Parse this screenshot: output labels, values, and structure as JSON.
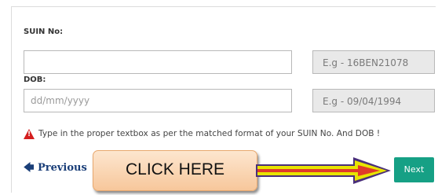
{
  "form": {
    "suin_label": "SUIN No:",
    "suin_value": "",
    "suin_hint": "E.g - 16BEN21078",
    "dob_label": "DOB:",
    "dob_placeholder": "dd/mm/yyyy",
    "dob_hint": "E.g - 09/04/1994"
  },
  "warning": {
    "icon": "warning-triangle-icon",
    "text": "Type in the proper textbox as per the matched format of your SUIN No. And DOB !",
    "color": "#d41e1e"
  },
  "nav": {
    "previous_label": "Previous",
    "next_label": "Next",
    "next_color": "#16a085"
  },
  "annotation": {
    "callout_text": "CLICK HERE",
    "arrow_icon": "right-arrow-icon"
  }
}
